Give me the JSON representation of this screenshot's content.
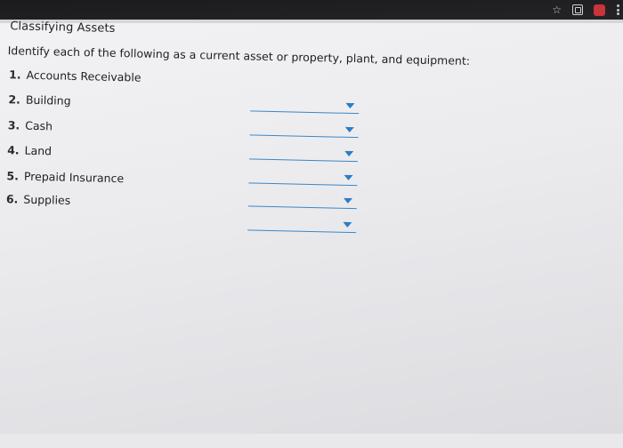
{
  "heading": {
    "title": "Classifying Assets",
    "instruction": "Identify each of the following as a current asset or property, plant, and equipment:"
  },
  "items": [
    {
      "number": "1.",
      "label": "Accounts Receivable",
      "selected": ""
    },
    {
      "number": "2.",
      "label": "Building",
      "selected": ""
    },
    {
      "number": "3.",
      "label": "Cash",
      "selected": ""
    },
    {
      "number": "4.",
      "label": "Land",
      "selected": ""
    },
    {
      "number": "5.",
      "label": "Prepaid Insurance",
      "selected": ""
    },
    {
      "number": "6.",
      "label": "Supplies",
      "selected": ""
    }
  ],
  "browser_icons": [
    "star-icon",
    "extension-icon",
    "profile-icon",
    "menu-icon"
  ],
  "colors": {
    "dropdown_accent": "#2b7cc9",
    "top_bar": "#1b1b1d",
    "page_background": "#ececef"
  }
}
